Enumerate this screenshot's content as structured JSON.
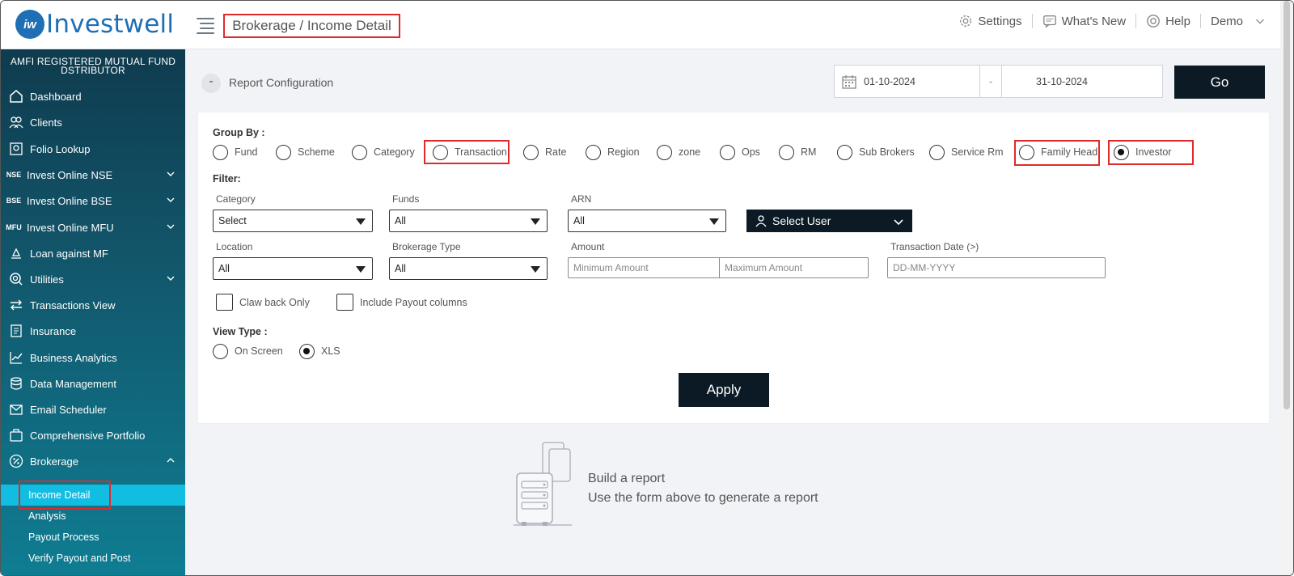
{
  "app": {
    "logo_text": "Investwell",
    "logo_mark": "iw"
  },
  "header": {
    "breadcrumb": "Brokerage / Income Detail",
    "links": [
      {
        "label": "Settings",
        "icon": "gear-icon"
      },
      {
        "label": "What's New",
        "icon": "message-icon"
      },
      {
        "label": "Help",
        "icon": "lifebuoy-icon"
      },
      {
        "label": "Demo",
        "icon": "chevron-down-icon"
      }
    ]
  },
  "sidebar": {
    "tagline": "AMFI REGISTERED MUTUAL FUND DSTRIBUTOR",
    "items": [
      {
        "label": "Dashboard",
        "icon": "home-icon"
      },
      {
        "label": "Clients",
        "icon": "users-icon"
      },
      {
        "label": "Folio Lookup",
        "icon": "folio-icon"
      },
      {
        "label": "Invest Online NSE",
        "icon_text": "NSE"
      },
      {
        "label": "Invest Online BSE",
        "icon_text": "BSE"
      },
      {
        "label": "Invest Online MFU",
        "icon_text": "MFU"
      },
      {
        "label": "Loan against MF",
        "icon": "loan-icon"
      },
      {
        "label": "Utilities",
        "icon": "utilities-icon"
      },
      {
        "label": "Transactions View",
        "icon": "transfer-icon"
      },
      {
        "label": "Insurance",
        "icon": "insurance-icon"
      },
      {
        "label": "Business Analytics",
        "icon": "analytics-icon"
      },
      {
        "label": "Data Management",
        "icon": "database-icon"
      },
      {
        "label": "Email Scheduler",
        "icon": "email-icon"
      },
      {
        "label": "Comprehensive Portfolio",
        "icon": "portfolio-icon"
      },
      {
        "label": "Brokerage",
        "icon": "percent-icon"
      }
    ],
    "sub_items": [
      {
        "label": "Income Detail"
      },
      {
        "label": "Analysis"
      },
      {
        "label": "Payout Process"
      },
      {
        "label": "Verify Payout and Post"
      }
    ]
  },
  "report": {
    "toggle": "-",
    "title": "Report Configuration",
    "date_from": "01-10-2024",
    "date_sep": "-",
    "date_to": "31-10-2024",
    "go_label": "Go"
  },
  "form": {
    "group_by_label": "Group By :",
    "group_by_options": [
      "Fund",
      "Scheme",
      "Category",
      "Transaction",
      "Rate",
      "Region",
      "zone",
      "Ops",
      "RM",
      "Sub Brokers",
      "Service Rm",
      "Family Head",
      "Investor"
    ],
    "group_by_selected": "Investor",
    "filter_label": "Filter:",
    "category_label": "Category",
    "category_value": "Select",
    "funds_label": "Funds",
    "funds_value": "All",
    "arn_label": "ARN",
    "arn_value": "All",
    "select_user_label": "Select User",
    "location_label": "Location",
    "location_value": "All",
    "brokerage_type_label": "Brokerage Type",
    "brokerage_type_value": "All",
    "amount_label": "Amount",
    "amount_min_placeholder": "Minimum Amount",
    "amount_max_placeholder": "Maximum Amount",
    "transaction_date_label": "Transaction Date (>)",
    "transaction_date_placeholder": "DD-MM-YYYY",
    "clawback_label": "Claw back Only",
    "payout_label": "Include Payout columns",
    "view_type_label": "View Type :",
    "view_type_options": [
      "On Screen",
      "XLS"
    ],
    "view_type_selected": "XLS",
    "apply_label": "Apply"
  },
  "empty_state": {
    "line1": "Build a report",
    "line2": "Use the form above to generate a report"
  }
}
